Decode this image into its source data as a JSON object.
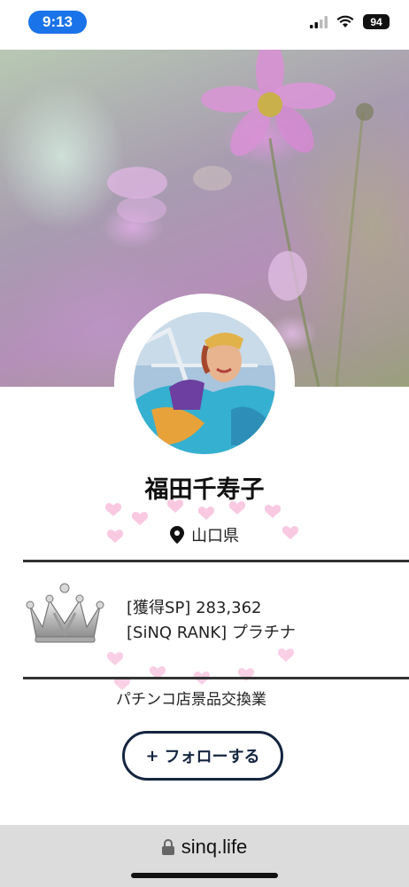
{
  "status_bar": {
    "time": "9:13",
    "battery": "94"
  },
  "profile": {
    "name": "福田千寿子",
    "location": "山口県",
    "stats": {
      "sp_label": "[獲得SP]",
      "sp_value": "283,362",
      "rank_label": "[SiNQ RANK]",
      "rank_value": "プラチナ"
    },
    "business": "パチンコ店景品交換業",
    "follow_label": "フォローする",
    "follow_icon": "+"
  },
  "browser": {
    "url": "sinq.life"
  },
  "colors": {
    "accent": "#1a73e8",
    "button_border": "#14253f",
    "heart": "#f28ac0"
  }
}
